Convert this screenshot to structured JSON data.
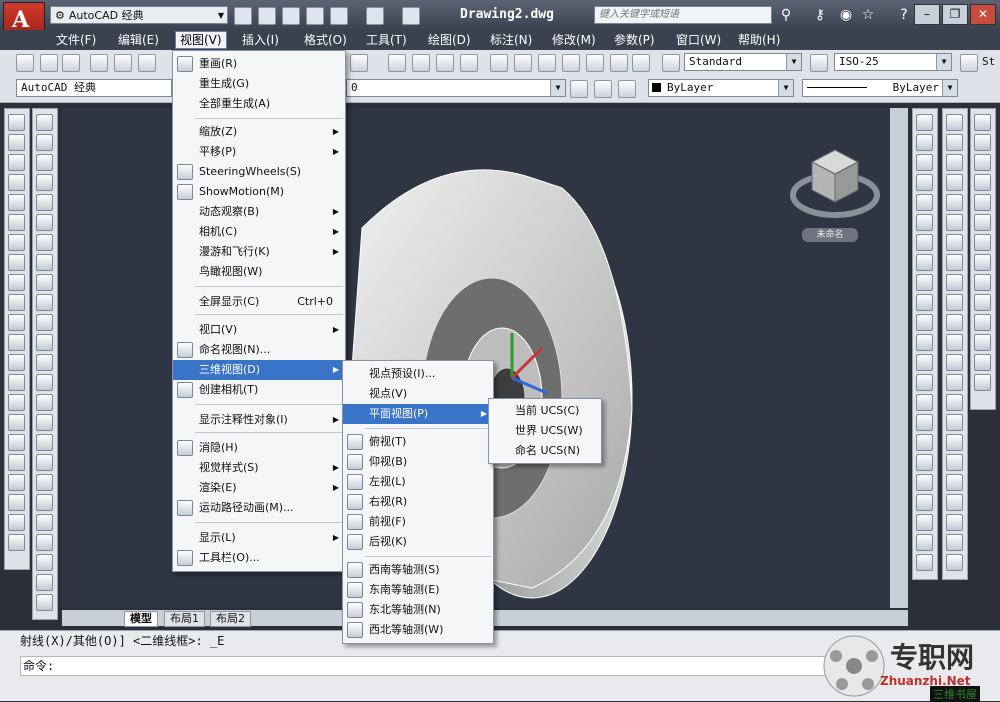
{
  "title_bar": {
    "workspace": "AutoCAD 经典",
    "document": "Drawing2.dwg",
    "search_placeholder": "键入关键字或短语",
    "help": "?"
  },
  "menubar": [
    {
      "label": "文件(F)"
    },
    {
      "label": "编辑(E)"
    },
    {
      "label": "视图(V)"
    },
    {
      "label": "插入(I)"
    },
    {
      "label": "格式(O)"
    },
    {
      "label": "工具(T)"
    },
    {
      "label": "绘图(D)"
    },
    {
      "label": "标注(N)"
    },
    {
      "label": "修改(M)"
    },
    {
      "label": "参数(P)"
    },
    {
      "label": "窗口(W)"
    },
    {
      "label": "帮助(H)"
    }
  ],
  "toolbar": {
    "text_style": "Standard",
    "dim_style": "ISO-25",
    "workspace2": "AutoCAD 经典",
    "layer": "0",
    "color": "ByLayer",
    "linetype": "ByLayer",
    "right_trunc": "St"
  },
  "view_menu": [
    {
      "label": "重画(R)",
      "icon": "redraw-icon"
    },
    {
      "label": "重生成(G)"
    },
    {
      "label": "全部重生成(A)"
    },
    {
      "label": "缩放(Z)",
      "sub": true
    },
    {
      "label": "平移(P)",
      "sub": true
    },
    {
      "label": "SteeringWheels(S)",
      "icon": "wheel-icon"
    },
    {
      "label": "ShowMotion(M)",
      "icon": "showmotion-icon"
    },
    {
      "label": "动态观察(B)",
      "sub": true
    },
    {
      "label": "相机(C)",
      "sub": true
    },
    {
      "label": "漫游和飞行(K)",
      "sub": true
    },
    {
      "label": "鸟瞰视图(W)"
    },
    {
      "label": "全屏显示(C)",
      "shortcut": "Ctrl+0"
    },
    {
      "label": "视口(V)",
      "sub": true
    },
    {
      "label": "命名视图(N)...",
      "icon": "named-view-icon"
    },
    {
      "label": "三维视图(D)",
      "sub": true
    },
    {
      "label": "创建相机(T)",
      "icon": "camera-icon"
    },
    {
      "label": "显示注释性对象(I)",
      "sub": true
    },
    {
      "label": "消隐(H)",
      "icon": "hide-icon"
    },
    {
      "label": "视觉样式(S)",
      "sub": true
    },
    {
      "label": "渲染(E)",
      "sub": true
    },
    {
      "label": "运动路径动画(M)...",
      "icon": "motion-path-icon"
    },
    {
      "label": "显示(L)",
      "sub": true
    },
    {
      "label": "工具栏(O)...",
      "icon": "toolbar-icon"
    }
  ],
  "view3d_menu": [
    {
      "label": "视点预设(I)..."
    },
    {
      "label": "视点(V)"
    },
    {
      "label": "平面视图(P)",
      "sub": true
    },
    {
      "label": "俯视(T)",
      "icon": "top-view-icon"
    },
    {
      "label": "仰视(B)",
      "icon": "bottom-view-icon"
    },
    {
      "label": "左视(L)",
      "icon": "left-view-icon"
    },
    {
      "label": "右视(R)",
      "icon": "right-view-icon"
    },
    {
      "label": "前视(F)",
      "icon": "front-view-icon"
    },
    {
      "label": "后视(K)",
      "icon": "back-view-icon"
    },
    {
      "label": "西南等轴测(S)",
      "icon": "sw-iso-icon"
    },
    {
      "label": "东南等轴测(E)",
      "icon": "se-iso-icon"
    },
    {
      "label": "东北等轴测(N)",
      "icon": "ne-iso-icon"
    },
    {
      "label": "西北等轴测(W)",
      "icon": "nw-iso-icon"
    }
  ],
  "plan_menu": [
    {
      "label": "当前 UCS(C)"
    },
    {
      "label": "世界 UCS(W)"
    },
    {
      "label": "命名 UCS(N)"
    }
  ],
  "viewcube": {
    "label": "未命名"
  },
  "tabs": [
    {
      "label": "模型"
    },
    {
      "label": "布局1"
    },
    {
      "label": "布局2"
    }
  ],
  "command": {
    "history": "射线(X)/其他(O)] <二维线框>: _E",
    "prompt": "命令:"
  },
  "logo": {
    "text": "专职网",
    "sub": "Zhuanzhi.Net",
    "tag": "三维书屋"
  }
}
